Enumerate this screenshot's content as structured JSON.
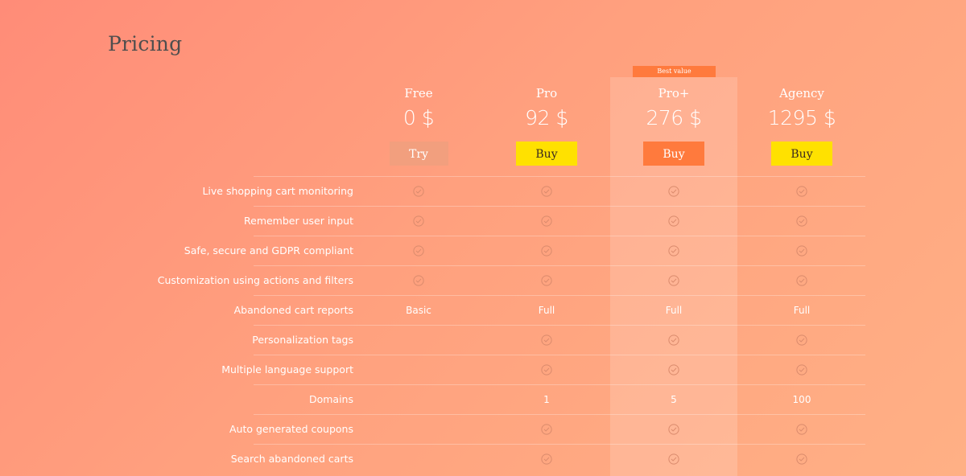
{
  "page": {
    "title": "Pricing",
    "best_badge": "Best value"
  },
  "plans": [
    {
      "name": "Free",
      "price": "0 $",
      "button": "Try"
    },
    {
      "name": "Pro",
      "price": "92 $",
      "button": "Buy"
    },
    {
      "name": "Pro+",
      "price": "276 $",
      "button": "Buy"
    },
    {
      "name": "Agency",
      "price": "1295 $",
      "button": "Buy"
    }
  ],
  "features": [
    {
      "label": "Live shopping cart monitoring",
      "values": [
        "check",
        "check",
        "check",
        "check"
      ]
    },
    {
      "label": "Remember user input",
      "values": [
        "check",
        "check",
        "check",
        "check"
      ]
    },
    {
      "label": "Safe, secure and GDPR compliant",
      "values": [
        "check",
        "check",
        "check",
        "check"
      ]
    },
    {
      "label": "Customization using actions and filters",
      "values": [
        "check",
        "check",
        "check",
        "check"
      ]
    },
    {
      "label": "Abandoned cart reports",
      "values": [
        "Basic",
        "Full",
        "Full",
        "Full"
      ]
    },
    {
      "label": "Personalization tags",
      "values": [
        "",
        "check",
        "check",
        "check"
      ]
    },
    {
      "label": "Multiple language support",
      "values": [
        "",
        "check",
        "check",
        "check"
      ]
    },
    {
      "label": "Domains",
      "values": [
        "",
        "1",
        "5",
        "100"
      ]
    },
    {
      "label": "Auto generated coupons",
      "values": [
        "",
        "check",
        "check",
        "check"
      ]
    },
    {
      "label": "Search abandoned carts",
      "values": [
        "",
        "check",
        "check",
        "check"
      ]
    }
  ],
  "colors": {
    "accent_orange": "#ff7a3d",
    "accent_yellow": "#ffe100",
    "try_button": "#f29f7e",
    "check_icon": "#d98a6c"
  },
  "icons": {
    "check": "check-circle-icon"
  }
}
